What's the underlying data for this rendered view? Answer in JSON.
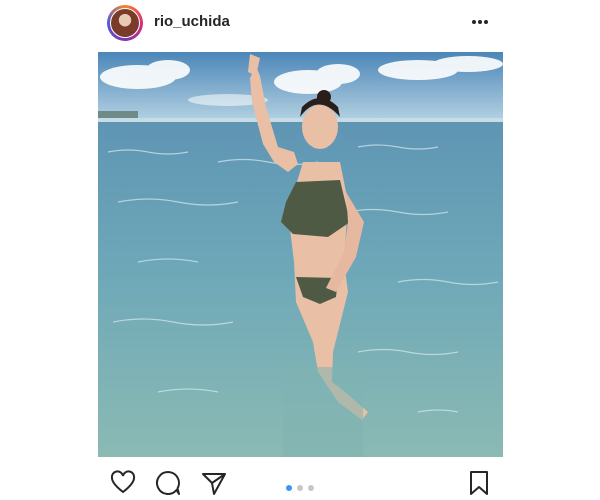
{
  "post": {
    "username": "rio_uchida",
    "photo_description": "",
    "carousel": {
      "total": 3,
      "active": 1
    }
  },
  "icons": {
    "avatar": "profile-avatar",
    "more": "more-options-icon",
    "like": "heart-icon",
    "comment": "comment-icon",
    "share": "share-icon",
    "save": "bookmark-icon"
  },
  "colors": {
    "active_dot": "#3897f0",
    "inactive_dot": "#c7c7c7",
    "text": "#262626"
  }
}
